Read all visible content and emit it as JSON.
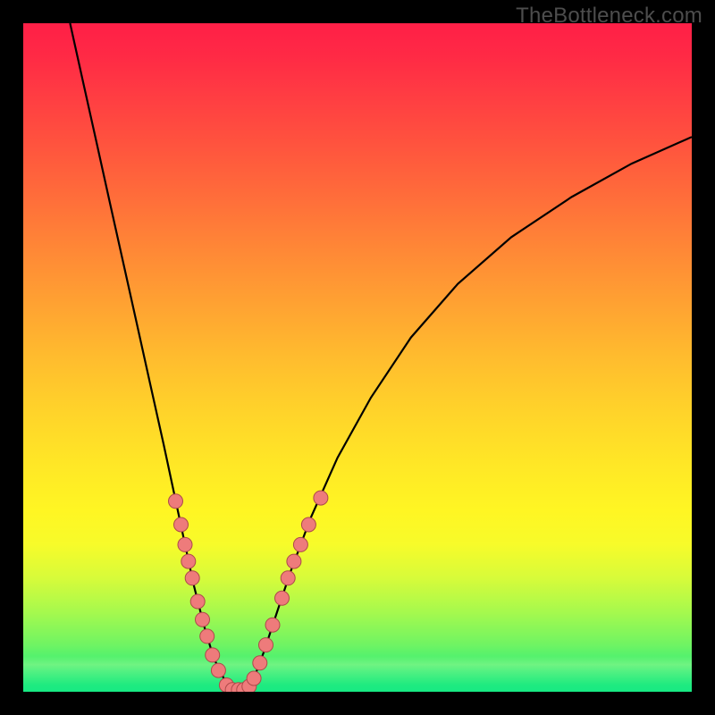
{
  "watermark": "TheBottleneck.com",
  "chart_data": {
    "type": "line",
    "title": "",
    "xlabel": "",
    "ylabel": "",
    "xlim": [
      0,
      100
    ],
    "ylim": [
      100,
      0
    ],
    "series": [
      {
        "name": "bottleneck_curve",
        "note": "Y is bottleneck percentage (0 at curve minimum, 100 at top).",
        "points": [
          {
            "x": 7.0,
            "y": 100.0
          },
          {
            "x": 9.0,
            "y": 91.0
          },
          {
            "x": 11.0,
            "y": 82.0
          },
          {
            "x": 13.0,
            "y": 73.0
          },
          {
            "x": 15.0,
            "y": 64.0
          },
          {
            "x": 17.0,
            "y": 55.0
          },
          {
            "x": 19.0,
            "y": 46.0
          },
          {
            "x": 21.0,
            "y": 37.0
          },
          {
            "x": 22.5,
            "y": 30.0
          },
          {
            "x": 24.0,
            "y": 23.0
          },
          {
            "x": 25.5,
            "y": 16.0
          },
          {
            "x": 27.0,
            "y": 10.0
          },
          {
            "x": 28.5,
            "y": 5.0
          },
          {
            "x": 30.0,
            "y": 2.0
          },
          {
            "x": 31.5,
            "y": 0.3
          },
          {
            "x": 33.0,
            "y": 0.3
          },
          {
            "x": 34.5,
            "y": 2.0
          },
          {
            "x": 36.0,
            "y": 6.0
          },
          {
            "x": 38.0,
            "y": 12.0
          },
          {
            "x": 40.0,
            "y": 18.0
          },
          {
            "x": 43.0,
            "y": 26.0
          },
          {
            "x": 47.0,
            "y": 35.0
          },
          {
            "x": 52.0,
            "y": 44.0
          },
          {
            "x": 58.0,
            "y": 53.0
          },
          {
            "x": 65.0,
            "y": 61.0
          },
          {
            "x": 73.0,
            "y": 68.0
          },
          {
            "x": 82.0,
            "y": 74.0
          },
          {
            "x": 91.0,
            "y": 79.0
          },
          {
            "x": 100.0,
            "y": 83.0
          }
        ]
      }
    ],
    "markers": {
      "name": "sample_points",
      "note": "Salmon markers along the curve near the minimum.",
      "points": [
        {
          "x": 22.8,
          "y": 28.5
        },
        {
          "x": 23.6,
          "y": 25.0
        },
        {
          "x": 24.2,
          "y": 22.0
        },
        {
          "x": 24.7,
          "y": 19.5
        },
        {
          "x": 25.3,
          "y": 17.0
        },
        {
          "x": 26.1,
          "y": 13.5
        },
        {
          "x": 26.8,
          "y": 10.8
        },
        {
          "x": 27.5,
          "y": 8.3
        },
        {
          "x": 28.3,
          "y": 5.5
        },
        {
          "x": 29.2,
          "y": 3.2
        },
        {
          "x": 30.4,
          "y": 1.0
        },
        {
          "x": 31.3,
          "y": 0.3
        },
        {
          "x": 32.2,
          "y": 0.3
        },
        {
          "x": 33.0,
          "y": 0.3
        },
        {
          "x": 33.8,
          "y": 0.8
        },
        {
          "x": 34.5,
          "y": 2.0
        },
        {
          "x": 35.4,
          "y": 4.3
        },
        {
          "x": 36.3,
          "y": 7.0
        },
        {
          "x": 37.3,
          "y": 10.0
        },
        {
          "x": 38.7,
          "y": 14.0
        },
        {
          "x": 39.6,
          "y": 17.0
        },
        {
          "x": 40.5,
          "y": 19.5
        },
        {
          "x": 41.5,
          "y": 22.0
        },
        {
          "x": 42.7,
          "y": 25.0
        },
        {
          "x": 44.5,
          "y": 29.0
        }
      ]
    }
  }
}
